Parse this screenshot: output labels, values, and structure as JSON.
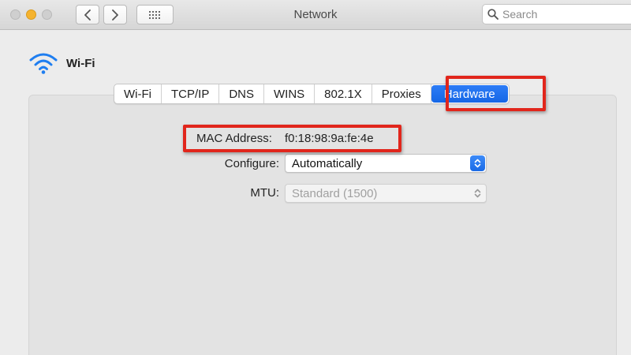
{
  "window": {
    "title": "Network"
  },
  "toolbar": {
    "search_placeholder": "Search"
  },
  "header": {
    "interface_name": "Wi-Fi"
  },
  "tabs": [
    {
      "label": "Wi-Fi"
    },
    {
      "label": "TCP/IP"
    },
    {
      "label": "DNS"
    },
    {
      "label": "WINS"
    },
    {
      "label": "802.1X"
    },
    {
      "label": "Proxies"
    },
    {
      "label": "Hardware",
      "selected": true
    }
  ],
  "hardware": {
    "mac_label": "MAC Address:",
    "mac_value": "f0:18:98:9a:fe:4e",
    "configure_label": "Configure:",
    "configure_value": "Automatically",
    "mtu_label": "MTU:",
    "mtu_value": "Standard (1500)"
  },
  "colors": {
    "accent": "#1567e6",
    "highlight": "#e1261c"
  },
  "icons": [
    "wifi-icon",
    "chevron-left-icon",
    "chevron-right-icon",
    "grid-icon",
    "search-icon",
    "stepper-icon"
  ]
}
